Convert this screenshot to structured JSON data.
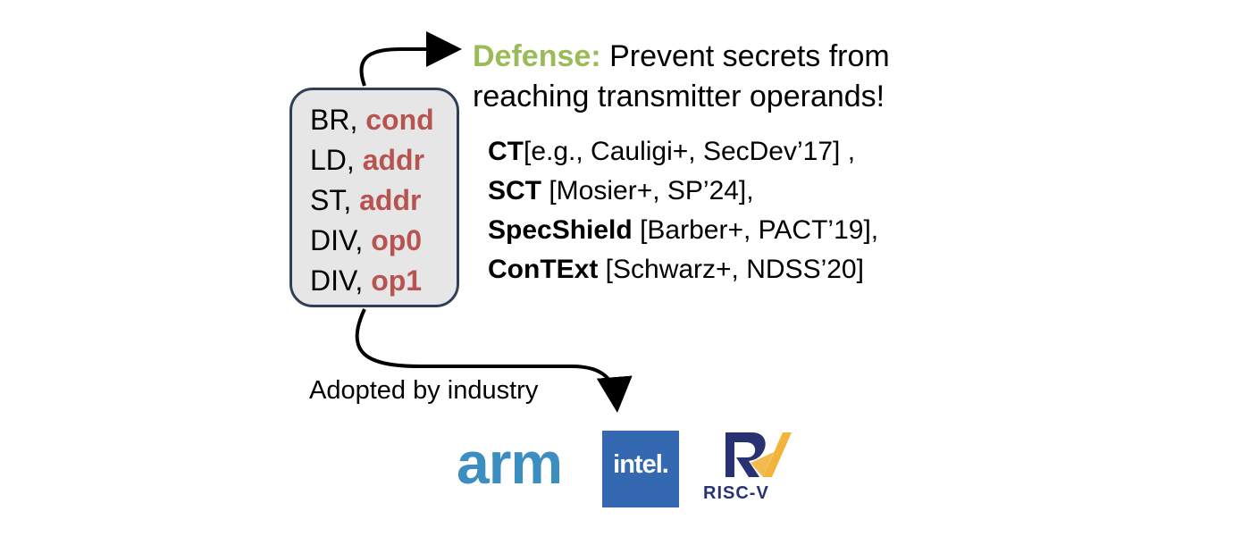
{
  "instructions": [
    {
      "op": "BR,",
      "operand": "cond"
    },
    {
      "op": "LD,",
      "operand": "addr"
    },
    {
      "op": "ST,",
      "operand": "addr"
    },
    {
      "op": "DIV,",
      "operand": "op0"
    },
    {
      "op": "DIV,",
      "operand": "op1"
    }
  ],
  "defense": {
    "label": "Defense:",
    "line1": "Prevent secrets from",
    "line2": "reaching transmitter operands!"
  },
  "references": [
    {
      "name": "CT",
      "cite": "[e.g., Cauligi+, SecDev’17] ,"
    },
    {
      "name": "SCT",
      "cite": "[Mosier+, SP’24],"
    },
    {
      "name": "SpecShield",
      "cite": "[Barber+, PACT’19],"
    },
    {
      "name": "ConTExt",
      "cite": "[Schwarz+, NDSS’20]"
    }
  ],
  "adoption": {
    "caption": "Adopted by industry"
  },
  "logos": {
    "arm": "arm",
    "intel": "intel.",
    "riscv": "RISC-V"
  },
  "colors": {
    "operand": "#b85450",
    "defense_label": "#9bbb59",
    "box_fill": "#e6e6e6",
    "box_border": "#2f3f55",
    "arm": "#3d8ec0",
    "intel": "#3468b0",
    "riscv_gold": "#f2b43a",
    "riscv_blue": "#283272"
  }
}
